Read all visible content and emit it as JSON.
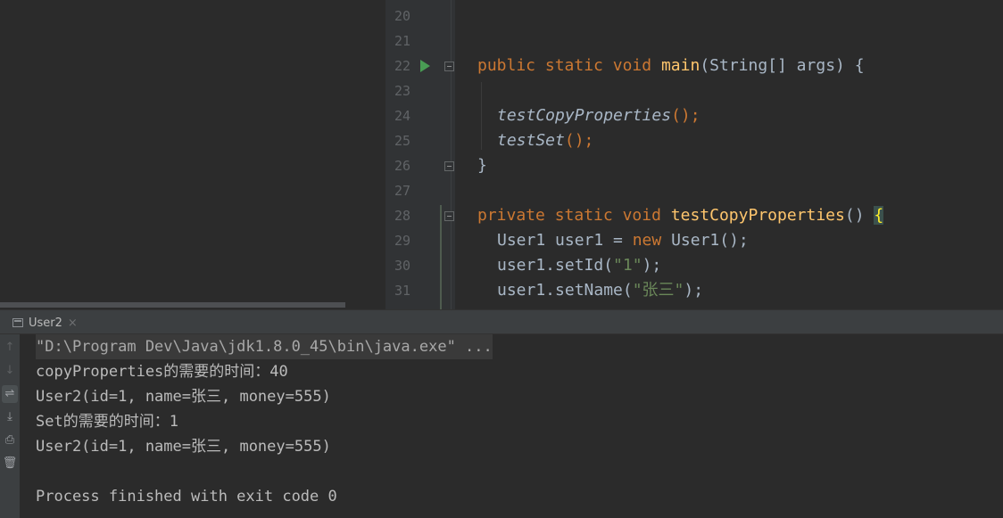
{
  "editor": {
    "line_numbers": [
      "20",
      "21",
      "22",
      "23",
      "24",
      "25",
      "26",
      "27",
      "28",
      "29",
      "30",
      "31"
    ],
    "code": {
      "l22": {
        "kw1": "public",
        "kw2": "static",
        "kw3": "void",
        "name": "main",
        "rest": "(String[] args) {"
      },
      "l24": {
        "call": "testCopyProperties",
        "rest": "();"
      },
      "l25": {
        "call": "testSet",
        "rest": "();"
      },
      "l26": {
        "text": "}"
      },
      "l28": {
        "kw1": "private",
        "kw2": "static",
        "kw3": "void",
        "name": "testCopyProperties",
        "rest": "() ",
        "brace": "{"
      },
      "l29": {
        "type": "User1 user1 = ",
        "kw": "new",
        "rest": " User1();"
      },
      "l30": {
        "call": "user1.setId(",
        "str": "\"1\"",
        "rest": ");"
      },
      "l31": {
        "call": "user1.setName(",
        "str": "\"张三\"",
        "rest": ");"
      }
    }
  },
  "run_panel": {
    "tab_label": "User2",
    "tab_close": "×",
    "toolbar_icons": [
      "up-arrow-icon",
      "down-arrow-icon",
      "soft-wrap-icon",
      "scroll-to-end-icon",
      "print-icon",
      "trash-icon"
    ],
    "toolbar_glyphs": [
      "↑",
      "↓",
      "⇌",
      "⤓",
      "⎙",
      "🗑"
    ],
    "console": [
      "\"D:\\Program Dev\\Java\\jdk1.8.0_45\\bin\\java.exe\" ...",
      "copyProperties的需要的时间：40",
      "User2(id=1, name=张三, money=555)",
      "Set的需要的时间：1",
      "User2(id=1, name=张三, money=555)",
      "",
      "Process finished with exit code 0"
    ]
  },
  "colors": {
    "editor_bg": "#2b2b2b",
    "gutter_bg": "#313335",
    "keyword": "#cc7832",
    "function": "#ffc66d",
    "string": "#6a8759",
    "text": "#a9b7c6"
  }
}
